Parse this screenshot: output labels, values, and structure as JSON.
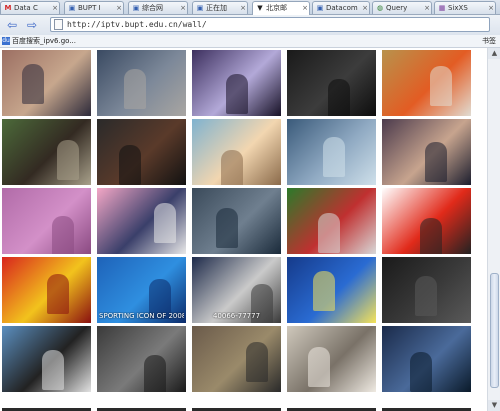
{
  "tabs": [
    {
      "label": "Data C",
      "favicon": "M",
      "favicon_color": "#d42a2a",
      "active": false
    },
    {
      "label": "BUPT I",
      "favicon": "▣",
      "favicon_color": "#345fb0",
      "active": false
    },
    {
      "label": "综合网",
      "favicon": "▣",
      "favicon_color": "#345fb0",
      "active": false
    },
    {
      "label": "正在加",
      "favicon": "▣",
      "favicon_color": "#345fb0",
      "active": false
    },
    {
      "label": "北京邮",
      "favicon": "▼",
      "favicon_color": "#222222",
      "active": true
    },
    {
      "label": "Datacom",
      "favicon": "▣",
      "favicon_color": "#345fb0",
      "active": false
    },
    {
      "label": "Query",
      "favicon": "◍",
      "favicon_color": "#2a7a2a",
      "active": false
    },
    {
      "label": "SixXS",
      "favicon": "▦",
      "favicon_color": "#7a3a9a",
      "active": false
    }
  ],
  "nav": {
    "back_icon": "⇦",
    "forward_icon": "⇨",
    "url": "http://iptv.bupt.edu.cn/wall/"
  },
  "bookmarks": {
    "item_label": "百度搜索_ipv6.go...",
    "right_label": "书签"
  },
  "thumbs": [
    {
      "caption": "",
      "colors": [
        "#9c6f63",
        "#c7a78d",
        "#2d2a3a"
      ]
    },
    {
      "caption": "",
      "colors": [
        "#3a4a62",
        "#7c8899",
        "#a9a6a2"
      ]
    },
    {
      "caption": "",
      "colors": [
        "#3c2f5e",
        "#b3a9d8",
        "#171126"
      ]
    },
    {
      "caption": "",
      "colors": [
        "#1a1a1a",
        "#3c3c3c",
        "#0d0d0d"
      ]
    },
    {
      "caption": "",
      "colors": [
        "#b8924c",
        "#e35c23",
        "#e1dcd2"
      ]
    },
    {
      "caption": "",
      "colors": [
        "#4c6a3a",
        "#332a22",
        "#a9a18b"
      ]
    },
    {
      "caption": "",
      "colors": [
        "#2a2a2a",
        "#5a3a2a",
        "#111111"
      ]
    },
    {
      "caption": "",
      "colors": [
        "#7fb2cf",
        "#f2d6b0",
        "#8a6a4a"
      ]
    },
    {
      "caption": "",
      "colors": [
        "#3a5a7a",
        "#8fa9c2",
        "#cfe0ea"
      ]
    },
    {
      "caption": "",
      "colors": [
        "#4b3a4c",
        "#c7a48e",
        "#1c1e2e"
      ]
    },
    {
      "caption": "",
      "colors": [
        "#b16ba8",
        "#d390c8",
        "#8a4a82"
      ]
    },
    {
      "caption": "",
      "colors": [
        "#f4a7c6",
        "#3a3f6a",
        "#e8e8e8"
      ]
    },
    {
      "caption": "",
      "colors": [
        "#3a4a5a",
        "#6f7f8f",
        "#1a2a3a"
      ]
    },
    {
      "caption": "",
      "colors": [
        "#2b7a2a",
        "#c03030",
        "#d8d8d8"
      ]
    },
    {
      "caption": "",
      "colors": [
        "#ffffff",
        "#e12a1a",
        "#222222"
      ]
    },
    {
      "caption": "",
      "colors": [
        "#d8251d",
        "#f2c31d",
        "#8a1010"
      ]
    },
    {
      "caption": "SPORTING ICON OF 2008",
      "colors": [
        "#1e62b8",
        "#2f8fe0",
        "#0b2a6a"
      ]
    },
    {
      "caption": "40066-77777",
      "colors": [
        "#1d2a4a",
        "#cacaca",
        "#3a3a3a"
      ]
    },
    {
      "caption": "",
      "colors": [
        "#153a8a",
        "#2a6bd2",
        "#f5e35a"
      ]
    },
    {
      "caption": "",
      "colors": [
        "#1a1a1a",
        "#3a3a3a",
        "#5a5a5a"
      ]
    },
    {
      "caption": "",
      "colors": [
        "#5b8fc0",
        "#222222",
        "#e2e2e2"
      ]
    },
    {
      "caption": "",
      "colors": [
        "#3a3a3a",
        "#7a7a7a",
        "#1a1a1a"
      ]
    },
    {
      "caption": "",
      "colors": [
        "#6a5a4a",
        "#9a8a6a",
        "#2a2a2a"
      ]
    },
    {
      "caption": "",
      "colors": [
        "#cfc8bc",
        "#7a7268",
        "#efeae2"
      ]
    },
    {
      "caption": "",
      "colors": [
        "#1a2a4a",
        "#4a6a9a",
        "#0a1a2a"
      ]
    }
  ]
}
